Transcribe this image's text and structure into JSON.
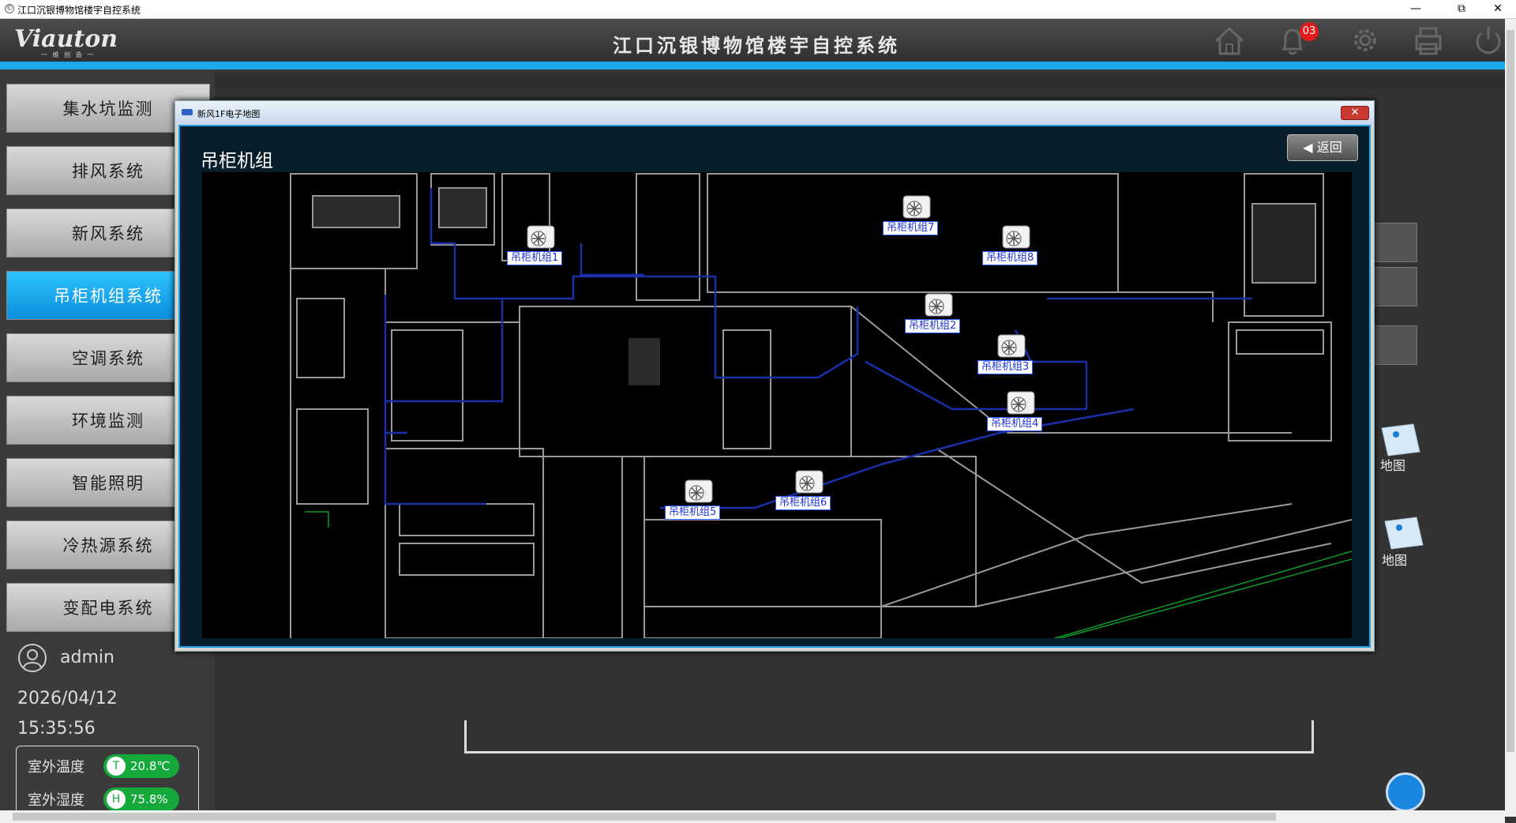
{
  "window": {
    "title": "江口沉银博物馆楼宇自控系统",
    "minimize": "—",
    "restore": "⧉",
    "close": "✕"
  },
  "header": {
    "logo": "Viauton",
    "logo_sub": "一 维 创 造 一",
    "title": "江口沉银博物馆楼宇自控系统",
    "alarm_count": "03"
  },
  "sidebar": {
    "items": [
      {
        "label": "集水坑监测"
      },
      {
        "label": "排风系统"
      },
      {
        "label": "新风系统"
      },
      {
        "label": "吊柜机组系统",
        "active": true
      },
      {
        "label": "空调系统"
      },
      {
        "label": "环境监测"
      },
      {
        "label": "智能照明"
      },
      {
        "label": "冷热源系统"
      },
      {
        "label": "变配电系统"
      }
    ],
    "user": "admin",
    "date": "2026/04/12",
    "time": "15:35:56",
    "weather": {
      "temp_label": "室外温度",
      "temp_value": "20.8℃",
      "humidity_label": "室外湿度",
      "humidity_value": "75.8%"
    }
  },
  "background": {
    "map_label_1": "地图",
    "map_label_2": "地图"
  },
  "dialog": {
    "title": "新风1F电子地图",
    "close": "✕",
    "panel_title": "吊柜机组",
    "back_label": "◀ 返回",
    "units": [
      {
        "label": "吊柜机组1"
      },
      {
        "label": "吊柜机组2"
      },
      {
        "label": "吊柜机组3"
      },
      {
        "label": "吊柜机组4"
      },
      {
        "label": "吊柜机组5"
      },
      {
        "label": "吊柜机组6"
      },
      {
        "label": "吊柜机组7"
      },
      {
        "label": "吊柜机组8"
      }
    ]
  },
  "colors": {
    "accent": "#19a8ea",
    "active_nav": "#0c8fdb",
    "badge": "#e21b1b",
    "weather_pill": "#15a83a",
    "floorplan_line": "#9a9a9a",
    "duct_line": "#1a2fa8"
  }
}
